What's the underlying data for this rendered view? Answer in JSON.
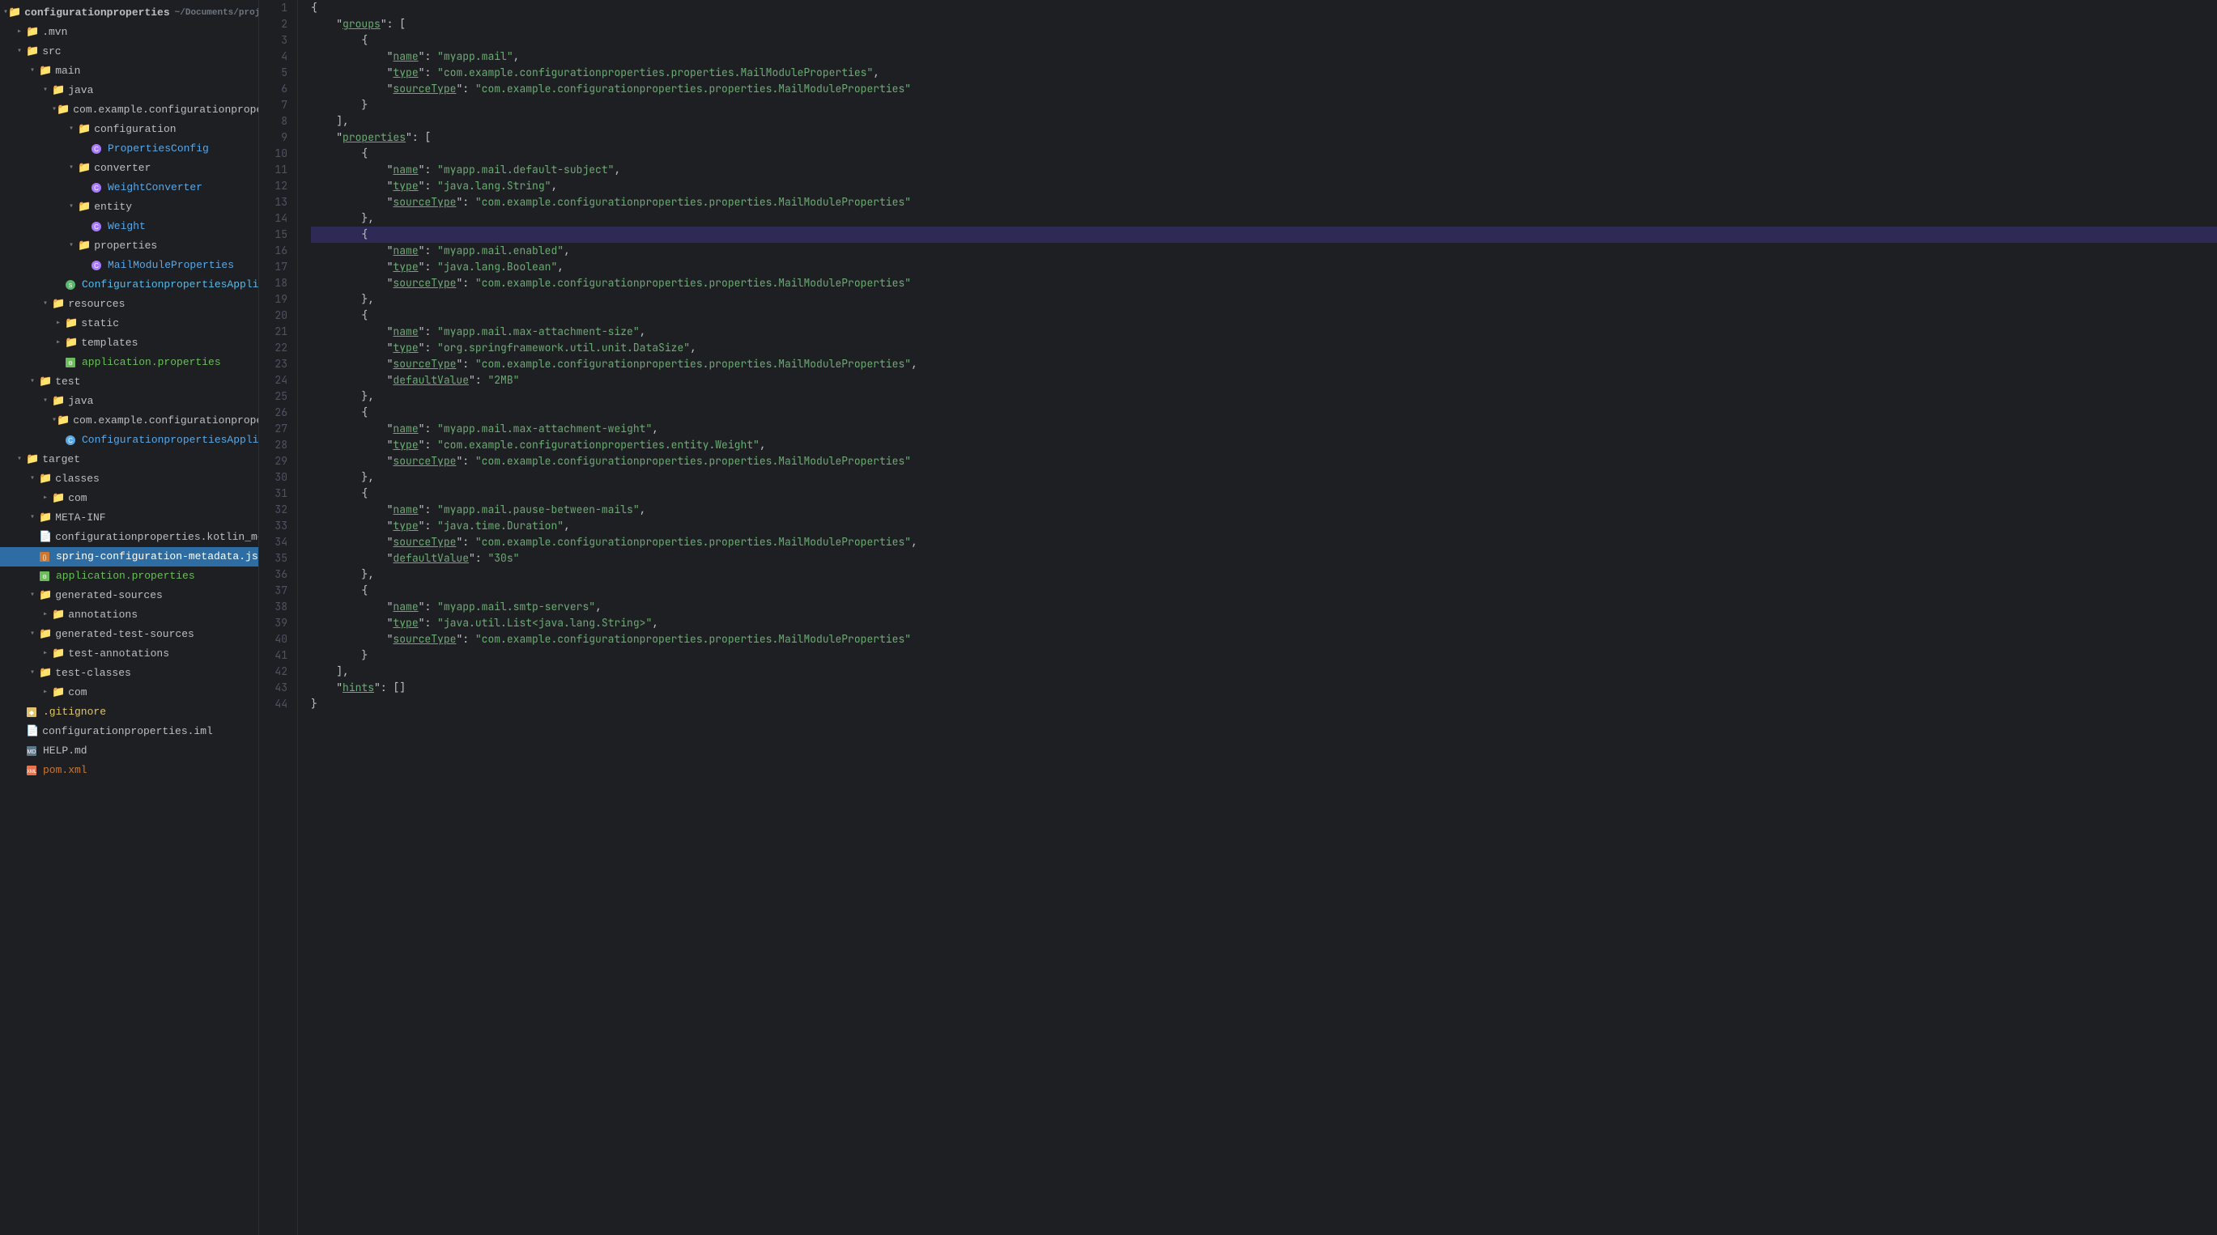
{
  "sidebar": {
    "root_label": "configurationproperties",
    "root_path": "~/Documents/projects/personal/learnings/confi",
    "items": [
      {
        "id": "mvn",
        "label": ".mvn",
        "type": "folder",
        "depth": 1,
        "open": false
      },
      {
        "id": "src",
        "label": "src",
        "type": "folder",
        "depth": 1,
        "open": true
      },
      {
        "id": "main",
        "label": "main",
        "type": "folder",
        "depth": 2,
        "open": true
      },
      {
        "id": "java",
        "label": "java",
        "type": "folder",
        "depth": 3,
        "open": true
      },
      {
        "id": "com_example",
        "label": "com.example.configurationproperties",
        "type": "folder",
        "depth": 4,
        "open": true
      },
      {
        "id": "configuration",
        "label": "configuration",
        "type": "folder",
        "depth": 5,
        "open": true
      },
      {
        "id": "PropertiesConfig",
        "label": "PropertiesConfig",
        "type": "kotlin",
        "depth": 6
      },
      {
        "id": "converter",
        "label": "converter",
        "type": "folder",
        "depth": 5,
        "open": true
      },
      {
        "id": "WeightConverter",
        "label": "WeightConverter",
        "type": "kotlin",
        "depth": 6
      },
      {
        "id": "entity",
        "label": "entity",
        "type": "folder",
        "depth": 5,
        "open": true
      },
      {
        "id": "Weight",
        "label": "Weight",
        "type": "kotlin",
        "depth": 6
      },
      {
        "id": "properties",
        "label": "properties",
        "type": "folder",
        "depth": 5,
        "open": true
      },
      {
        "id": "MailModuleProperties",
        "label": "MailModuleProperties",
        "type": "kotlin",
        "depth": 6
      },
      {
        "id": "ConfigurationpropertiesApplication",
        "label": "ConfigurationpropertiesApplication",
        "type": "spring",
        "depth": 5
      },
      {
        "id": "resources",
        "label": "resources",
        "type": "folder",
        "depth": 3,
        "open": true
      },
      {
        "id": "static",
        "label": "static",
        "type": "folder",
        "depth": 4,
        "open": false
      },
      {
        "id": "templates",
        "label": "templates",
        "type": "folder",
        "depth": 4,
        "open": false
      },
      {
        "id": "application_properties",
        "label": "application.properties",
        "type": "properties",
        "depth": 4
      },
      {
        "id": "test",
        "label": "test",
        "type": "folder",
        "depth": 2,
        "open": true
      },
      {
        "id": "java_test",
        "label": "java",
        "type": "folder",
        "depth": 3,
        "open": true
      },
      {
        "id": "com_example_test",
        "label": "com.example.configurationproperties",
        "type": "folder",
        "depth": 4,
        "open": true
      },
      {
        "id": "ConfigurationpropertiesApplicationTests",
        "label": "ConfigurationpropertiesApplicationTests",
        "type": "apptest",
        "depth": 5
      },
      {
        "id": "target",
        "label": "target",
        "type": "folder",
        "depth": 1,
        "open": true
      },
      {
        "id": "classes",
        "label": "classes",
        "type": "folder",
        "depth": 2,
        "open": true
      },
      {
        "id": "com_classes",
        "label": "com",
        "type": "folder",
        "depth": 3,
        "open": false
      },
      {
        "id": "META-INF",
        "label": "META-INF",
        "type": "folder",
        "depth": 2,
        "open": true
      },
      {
        "id": "configurationproperties_kotlin_module",
        "label": "configurationproperties.kotlin_module",
        "type": "file",
        "depth": 3
      },
      {
        "id": "spring_configuration_metadata",
        "label": "spring-configuration-metadata.json",
        "type": "json",
        "depth": 3,
        "selected": true
      },
      {
        "id": "application_properties2",
        "label": "application.properties",
        "type": "properties",
        "depth": 2
      },
      {
        "id": "generated_sources",
        "label": "generated-sources",
        "type": "folder",
        "depth": 2,
        "open": true
      },
      {
        "id": "annotations",
        "label": "annotations",
        "type": "folder",
        "depth": 3,
        "open": false
      },
      {
        "id": "generated_test_sources",
        "label": "generated-test-sources",
        "type": "folder",
        "depth": 2,
        "open": true
      },
      {
        "id": "test_annotations",
        "label": "test-annotations",
        "type": "folder",
        "depth": 3,
        "open": false
      },
      {
        "id": "test_classes",
        "label": "test-classes",
        "type": "folder",
        "depth": 2,
        "open": true
      },
      {
        "id": "com_test",
        "label": "com",
        "type": "folder",
        "depth": 3,
        "open": false
      },
      {
        "id": "gitignore",
        "label": ".gitignore",
        "type": "gitignore",
        "depth": 1
      },
      {
        "id": "configurationproperties_iml",
        "label": "configurationproperties.iml",
        "type": "iml",
        "depth": 1
      },
      {
        "id": "HELP_md",
        "label": "HELP.md",
        "type": "md",
        "depth": 1
      },
      {
        "id": "pom_xml",
        "label": "pom.xml",
        "type": "xml",
        "depth": 1
      }
    ]
  },
  "editor": {
    "filename": "spring-configuration-metadata.json",
    "lines": [
      {
        "n": 1,
        "content": "{",
        "highlighted": false
      },
      {
        "n": 2,
        "content": "    \"groups\": [",
        "highlighted": false
      },
      {
        "n": 3,
        "content": "        {",
        "highlighted": false
      },
      {
        "n": 4,
        "content": "            \"name\": \"myapp.mail\",",
        "highlighted": false
      },
      {
        "n": 5,
        "content": "            \"type\": \"com.example.configurationproperties.properties.MailModuleProperties\",",
        "highlighted": false
      },
      {
        "n": 6,
        "content": "            \"sourceType\": \"com.example.configurationproperties.properties.MailModuleProperties\"",
        "highlighted": false
      },
      {
        "n": 7,
        "content": "        }",
        "highlighted": false
      },
      {
        "n": 8,
        "content": "    ],",
        "highlighted": false
      },
      {
        "n": 9,
        "content": "    \"properties\": [",
        "highlighted": false
      },
      {
        "n": 10,
        "content": "        {",
        "highlighted": false
      },
      {
        "n": 11,
        "content": "            \"name\": \"myapp.mail.default-subject\",",
        "highlighted": false
      },
      {
        "n": 12,
        "content": "            \"type\": \"java.lang.String\",",
        "highlighted": false
      },
      {
        "n": 13,
        "content": "            \"sourceType\": \"com.example.configurationproperties.properties.MailModuleProperties\"",
        "highlighted": false
      },
      {
        "n": 14,
        "content": "        },",
        "highlighted": false
      },
      {
        "n": 15,
        "content": "        {",
        "highlighted": true
      },
      {
        "n": 16,
        "content": "            \"name\": \"myapp.mail.enabled\",",
        "highlighted": false
      },
      {
        "n": 17,
        "content": "            \"type\": \"java.lang.Boolean\",",
        "highlighted": false
      },
      {
        "n": 18,
        "content": "            \"sourceType\": \"com.example.configurationproperties.properties.MailModuleProperties\"",
        "highlighted": false
      },
      {
        "n": 19,
        "content": "        },",
        "highlighted": false
      },
      {
        "n": 20,
        "content": "        {",
        "highlighted": false
      },
      {
        "n": 21,
        "content": "            \"name\": \"myapp.mail.max-attachment-size\",",
        "highlighted": false
      },
      {
        "n": 22,
        "content": "            \"type\": \"org.springframework.util.unit.DataSize\",",
        "highlighted": false
      },
      {
        "n": 23,
        "content": "            \"sourceType\": \"com.example.configurationproperties.properties.MailModuleProperties\",",
        "highlighted": false
      },
      {
        "n": 24,
        "content": "            \"defaultValue\": \"2MB\"",
        "highlighted": false
      },
      {
        "n": 25,
        "content": "        },",
        "highlighted": false
      },
      {
        "n": 26,
        "content": "        {",
        "highlighted": false
      },
      {
        "n": 27,
        "content": "            \"name\": \"myapp.mail.max-attachment-weight\",",
        "highlighted": false
      },
      {
        "n": 28,
        "content": "            \"type\": \"com.example.configurationproperties.entity.Weight\",",
        "highlighted": false
      },
      {
        "n": 29,
        "content": "            \"sourceType\": \"com.example.configurationproperties.properties.MailModuleProperties\"",
        "highlighted": false
      },
      {
        "n": 30,
        "content": "        },",
        "highlighted": false
      },
      {
        "n": 31,
        "content": "        {",
        "highlighted": false
      },
      {
        "n": 32,
        "content": "            \"name\": \"myapp.mail.pause-between-mails\",",
        "highlighted": false
      },
      {
        "n": 33,
        "content": "            \"type\": \"java.time.Duration\",",
        "highlighted": false
      },
      {
        "n": 34,
        "content": "            \"sourceType\": \"com.example.configurationproperties.properties.MailModuleProperties\",",
        "highlighted": false
      },
      {
        "n": 35,
        "content": "            \"defaultValue\": \"30s\"",
        "highlighted": false
      },
      {
        "n": 36,
        "content": "        },",
        "highlighted": false
      },
      {
        "n": 37,
        "content": "        {",
        "highlighted": false
      },
      {
        "n": 38,
        "content": "            \"name\": \"myapp.mail.smtp-servers\",",
        "highlighted": false
      },
      {
        "n": 39,
        "content": "            \"type\": \"java.util.List<java.lang.String>\",",
        "highlighted": false
      },
      {
        "n": 40,
        "content": "            \"sourceType\": \"com.example.configurationproperties.properties.MailModuleProperties\"",
        "highlighted": false
      },
      {
        "n": 41,
        "content": "        }",
        "highlighted": false
      },
      {
        "n": 42,
        "content": "    ],",
        "highlighted": false
      },
      {
        "n": 43,
        "content": "    \"hints\": []",
        "highlighted": false
      },
      {
        "n": 44,
        "content": "}",
        "highlighted": false
      }
    ]
  }
}
